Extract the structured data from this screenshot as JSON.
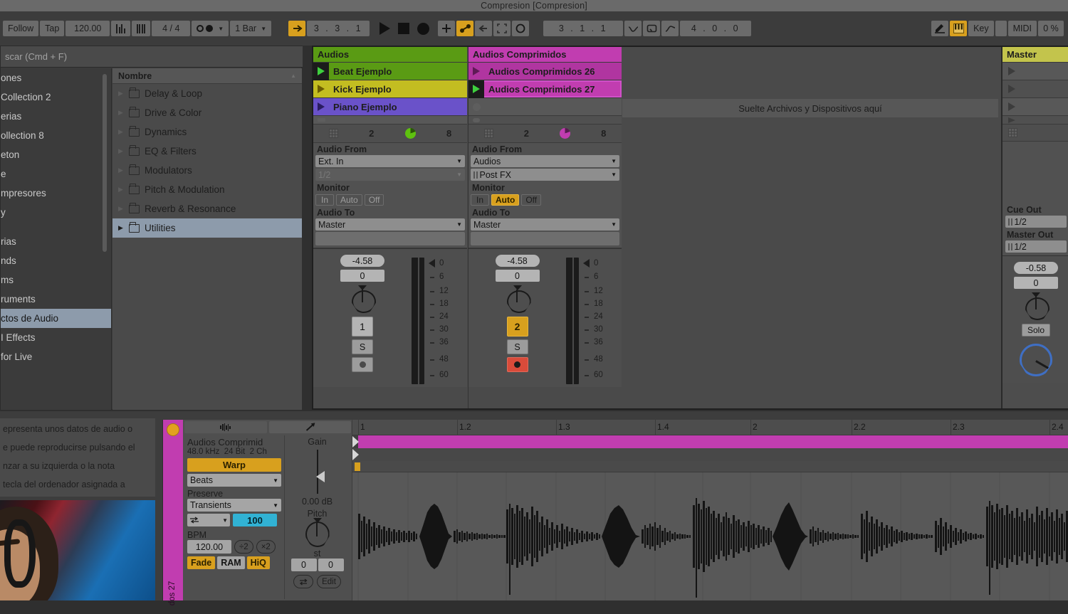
{
  "window": {
    "title": "Compresion  [Compresion]"
  },
  "control_bar": {
    "follow": "Follow",
    "tap": "Tap",
    "tempo": "120.00",
    "metronome_icon": "metronome-icon",
    "metronome_alt_icon": "metronome-pattern-icon",
    "time_signature": "4 / 4",
    "quantize_icon": "record-quantize-icon",
    "launch_quantization": "1 Bar",
    "arrangement_position": "3 . 3 . 1",
    "loop_start": "3 . 1 . 1",
    "loop_length": "4 . 0 . 0",
    "play_icon": "play-icon",
    "stop_icon": "stop-icon",
    "record_icon": "record-icon",
    "draw_icon": "draw-mode-icon",
    "key_label": "Key",
    "midi_label": "MIDI",
    "cpu_load": "0 %",
    "accent_amber": "#d8a01e"
  },
  "browser": {
    "search_placeholder": "scar (Cmd + F)",
    "sidebar_items": [
      {
        "label": "ones",
        "selected": false
      },
      {
        "label": "Collection 2",
        "selected": false
      },
      {
        "label": "erias",
        "selected": false
      },
      {
        "label": "ollection 8",
        "selected": false
      },
      {
        "label": "eton",
        "selected": false
      },
      {
        "label": "e",
        "selected": false
      },
      {
        "label": "mpresores",
        "selected": false
      },
      {
        "label": "y",
        "selected": false
      }
    ],
    "sidebar_items_2": [
      {
        "label": "rias",
        "selected": false
      },
      {
        "label": "nds",
        "selected": false
      },
      {
        "label": "ms",
        "selected": false
      },
      {
        "label": "ruments",
        "selected": false
      },
      {
        "label": "ctos de Audio",
        "selected": true
      },
      {
        "label": "I Effects",
        "selected": false
      },
      {
        "label": "for Live",
        "selected": false
      }
    ],
    "content_header": "Nombre",
    "sort_caret": "▲",
    "folders": [
      {
        "label": "Delay & Loop",
        "selected": false
      },
      {
        "label": "Drive & Color",
        "selected": false
      },
      {
        "label": "Dynamics",
        "selected": false
      },
      {
        "label": "EQ & Filters",
        "selected": false
      },
      {
        "label": "Modulators",
        "selected": false
      },
      {
        "label": "Pitch & Modulation",
        "selected": false
      },
      {
        "label": "Reverb & Resonance",
        "selected": false
      },
      {
        "label": "Utilities",
        "selected": true
      }
    ]
  },
  "session": {
    "drop_message": "Suelte Archivos y Dispositivos aquí",
    "tracks": [
      {
        "name": "Audios",
        "color": "#5a9b14",
        "clips": [
          {
            "label": "Beat Ejemplo",
            "color": "#5a9b14",
            "state": "playing"
          },
          {
            "label": "Kick Ejemplo",
            "color": "#c3bd21",
            "state": "stopped"
          },
          {
            "label": "Piano Ejemplo",
            "color": "#6a52c9",
            "state": "stopped"
          }
        ],
        "scene_count": "2",
        "scene_count_right": "8",
        "pie_color": "#5ec20f",
        "audio_from_label": "Audio From",
        "audio_from": "Ext. In",
        "audio_from_sub": "1/2",
        "monitor_label": "Monitor",
        "monitor_options": [
          "In",
          "Auto",
          "Off"
        ],
        "monitor_active": "",
        "audio_to_label": "Audio To",
        "audio_to": "Master",
        "volume_db": "-4.58",
        "pan": "0",
        "track_number": "1",
        "solo_label": "S",
        "armed": false
      },
      {
        "name": "Audios Comprimidos",
        "color": "#c13db0",
        "clips": [
          {
            "label": "Audios Comprimidos 26",
            "color": "#c13db0",
            "state": "stopped"
          },
          {
            "label": "Audios Comprimidos 27",
            "color": "#c13db0",
            "state": "playing_selected"
          }
        ],
        "scene_count": "2",
        "scene_count_right": "8",
        "pie_color": "#c13db0",
        "audio_from_label": "Audio From",
        "audio_from": "Audios",
        "audio_from_sub": "Post FX",
        "monitor_label": "Monitor",
        "monitor_options": [
          "In",
          "Auto",
          "Off"
        ],
        "monitor_active": "Auto",
        "audio_to_label": "Audio To",
        "audio_to": "Master",
        "volume_db": "-4.58",
        "pan": "0",
        "track_number": "2",
        "solo_label": "S",
        "armed": true
      }
    ],
    "meter_scale": [
      "0",
      "6",
      "12",
      "18",
      "24",
      "30",
      "36",
      "48",
      "60"
    ],
    "master": {
      "name": "Master",
      "cue_out_label": "Cue Out",
      "cue_out": "1/2",
      "master_out_label": "Master Out",
      "master_out": "1/2",
      "volume_db": "-0.58",
      "pan": "0",
      "solo_label": "Solo"
    }
  },
  "info_view": {
    "lines": [
      "epresenta unos datos de audio o",
      "e puede reproducirse pulsando el",
      "nzar a su izquierda o la nota",
      "tecla del ordenador asignada a"
    ]
  },
  "clip_view": {
    "strip_label": "dos 27",
    "tab_sample_icon": "waveform-icon",
    "tab_envelope_icon": "pencil-icon",
    "clip_name": "Audios Comprimid",
    "sample_rate": "48.0 kHz",
    "bit_depth": "24 Bit",
    "channels": "2 Ch",
    "warp_label": "Warp",
    "warp_mode": "Beats",
    "preserve_label": "Preserve",
    "preserve_mode": "Transients",
    "transient_loop_icon": "transient-loop-icon",
    "transient_envelope": "100",
    "bpm_label": "BPM",
    "bpm_value": "120.00",
    "bpm_half": "÷2",
    "bpm_double": "×2",
    "fade_label": "Fade",
    "ram_label": "RAM",
    "hiq_label": "HiQ",
    "gain_label": "Gain",
    "gain_value": "0.00 dB",
    "pitch_label": "Pitch",
    "pitch_unit": "st",
    "pitch_semitones": "0",
    "pitch_cents": "0",
    "reverse_icon": "reverse-icon",
    "edit_label": "Edit"
  },
  "editor": {
    "ruler_labels": [
      "1",
      "1.2",
      "1.3",
      "1.4",
      "2",
      "2.2",
      "2.3",
      "2.4"
    ],
    "loop_color": "#c13db0"
  }
}
